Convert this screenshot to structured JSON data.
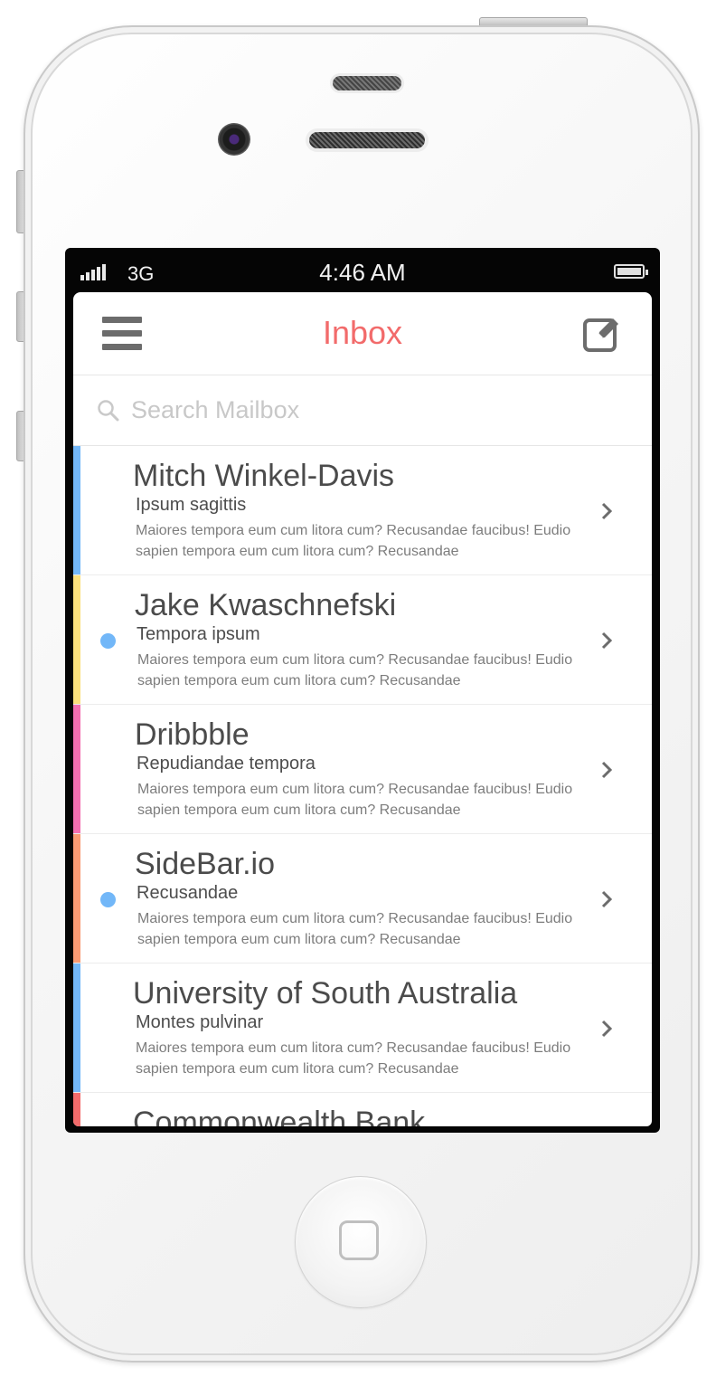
{
  "status_bar": {
    "carrier": "3G",
    "time": "4:46 AM",
    "signal_icon": "signal-bars-icon",
    "battery_icon": "battery-full-icon"
  },
  "nav": {
    "title": "Inbox",
    "menu_icon": "hamburger-menu-icon",
    "compose_icon": "compose-icon",
    "title_color": "#f26b6b"
  },
  "search": {
    "placeholder": "Search Mailbox",
    "icon": "search-icon"
  },
  "messages": [
    {
      "sender": "Mitch Winkel-Davis",
      "subject": "Ipsum sagittis",
      "preview": "Maiores tempora eum cum litora cum? Recusandae faucibus! Eudio sapien tempora eum cum litora cum? Recusandae",
      "unread": false,
      "color": "#72b7f8"
    },
    {
      "sender": "Jake Kwaschnefski",
      "subject": "Tempora ipsum",
      "preview": "Maiores tempora eum cum litora cum? Recusandae faucibus! Eudio sapien tempora eum cum litora cum? Recusandae",
      "unread": true,
      "color": "#fbe07c"
    },
    {
      "sender": "Dribbble",
      "subject": "Repudiandae tempora",
      "preview": "Maiores tempora eum cum litora cum? Recusandae faucibus! Eudio sapien tempora eum cum litora cum? Recusandae",
      "unread": false,
      "color": "#f36fb0"
    },
    {
      "sender": "SideBar.io",
      "subject": "Recusandae",
      "preview": "Maiores tempora eum cum litora cum? Recusandae faucibus! Eudio sapien tempora eum cum litora cum? Recusandae",
      "unread": true,
      "color": "#f99a73"
    },
    {
      "sender": "University of South Australia",
      "subject": "Montes pulvinar",
      "preview": "Maiores tempora eum cum litora cum? Recusandae faucibus! Eudio sapien tempora eum cum litora cum? Recusandae",
      "unread": false,
      "color": "#72b7f8"
    },
    {
      "sender": "Commonwealth Bank",
      "subject": "",
      "preview": "",
      "unread": false,
      "color": "#f36b6b"
    }
  ],
  "colors": {
    "unread_dot": "#72b7f8",
    "accent": "#f26b6b"
  }
}
